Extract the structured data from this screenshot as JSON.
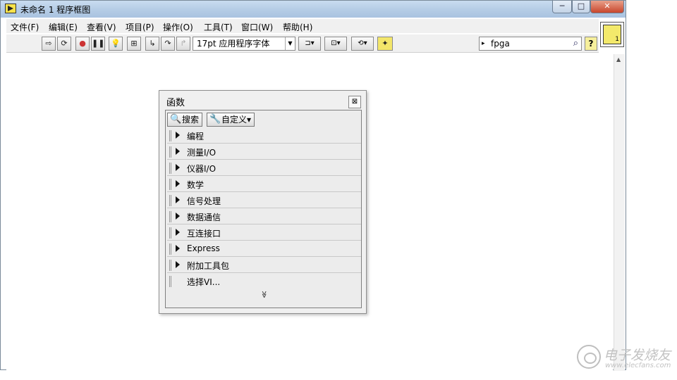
{
  "window": {
    "title": "未命名 1 程序框图",
    "min_label": "─",
    "max_label": "□",
    "close_label": "✕"
  },
  "menu": {
    "items": [
      "文件(F)",
      "编辑(E)",
      "查看(V)",
      "项目(P)",
      "操作(O)",
      "工具(T)",
      "窗口(W)",
      "帮助(H)"
    ]
  },
  "toolbar": {
    "font": "17pt 应用程序字体",
    "search_value": "fpga",
    "help_label": "?"
  },
  "connector": {
    "label": "1"
  },
  "palette": {
    "title": "函数",
    "close_label": "⊠",
    "search_label": "搜索",
    "customize_label": "自定义▾",
    "items": [
      "编程",
      "测量I/O",
      "仪器I/O",
      "数学",
      "信号处理",
      "数据通信",
      "互连接口",
      "Express",
      "附加工具包"
    ],
    "select_vi": "选择VI...",
    "more_label": "≫"
  },
  "watermark": {
    "brand": "电子发烧友",
    "url": "www.elecfans.com"
  }
}
